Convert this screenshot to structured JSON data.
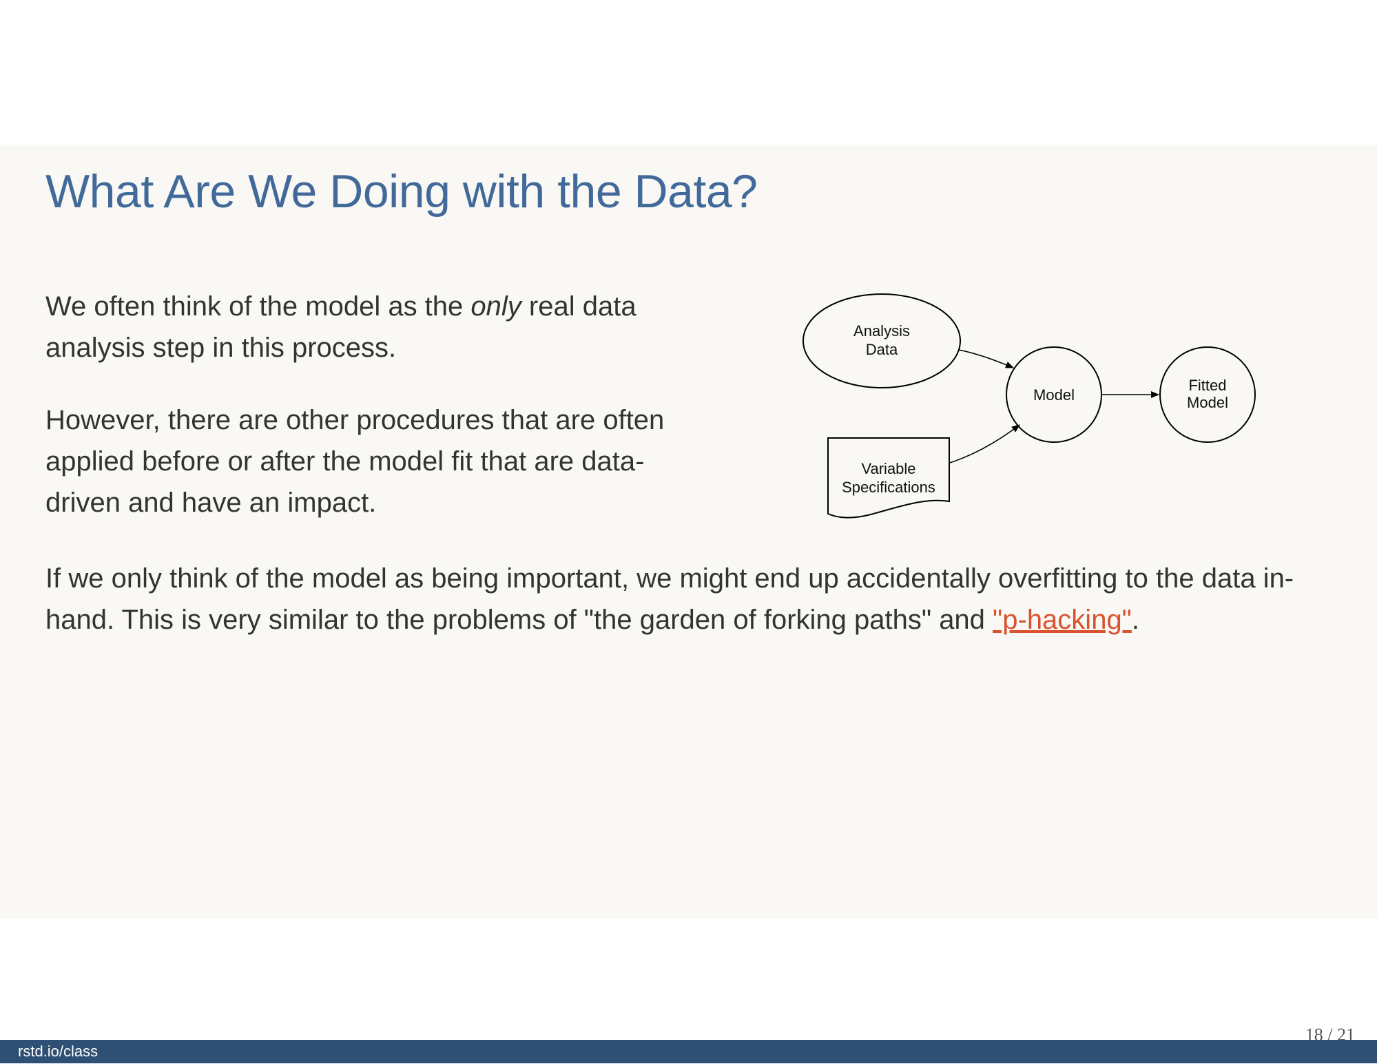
{
  "slide": {
    "title": "What Are We Doing with the Data?",
    "para1": {
      "before": "We often think of the model as the ",
      "emphasis": "only",
      "after": " real data analysis step in this process."
    },
    "para2": "However, there are other procedures that are often applied before or after the model fit that are data-driven and have an impact.",
    "para3": {
      "text": "If we only think of the model as being important, we might end up accidentally overfitting to the data in-hand. This is very similar to the problems of \"the garden of forking paths\" and ",
      "link_text": "\"p-hacking\"",
      "after": "."
    }
  },
  "diagram": {
    "nodes": {
      "analysis_data": [
        "Analysis",
        "Data"
      ],
      "model": "Model",
      "fitted_model": [
        "Fitted",
        "Model"
      ],
      "variable_specs": [
        "Variable",
        "Specifications"
      ]
    }
  },
  "footer": {
    "link": "rstd.io/class",
    "page": "18 / 21"
  }
}
